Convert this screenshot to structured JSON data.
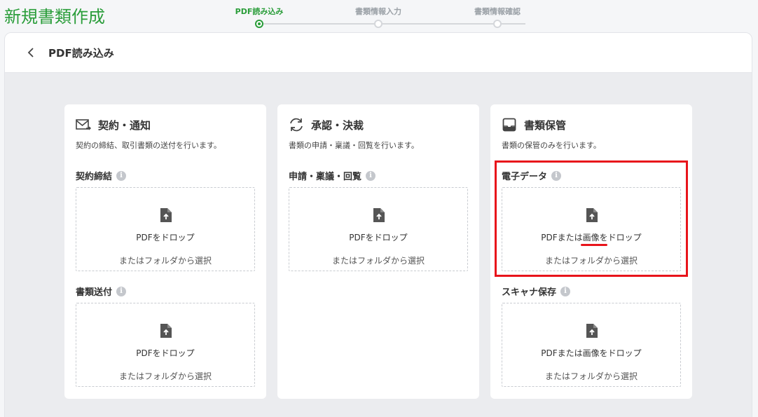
{
  "header": {
    "page_title": "新規書類作成"
  },
  "stepper": {
    "steps": [
      {
        "label": "PDF読み込み",
        "active": true
      },
      {
        "label": "書類情報入力",
        "active": false
      },
      {
        "label": "書類情報確認",
        "active": false
      }
    ]
  },
  "panel": {
    "title": "PDF読み込み"
  },
  "cards": [
    {
      "icon": "mail-send-icon",
      "title": "契約・通知",
      "desc": "契約の締結、取引書類の送付を行います。",
      "sections": [
        {
          "label": "契約締結",
          "drop_text": "PDFをドロップ",
          "drop_sub": "またはフォルダから選択"
        },
        {
          "label": "書類送付",
          "drop_text": "PDFをドロップ",
          "drop_sub": "またはフォルダから選択"
        }
      ]
    },
    {
      "icon": "refresh-icon",
      "title": "承認・決裁",
      "desc": "書類の申請・稟議・回覧を行います。",
      "sections": [
        {
          "label": "申請・稟議・回覧",
          "drop_text": "PDFをドロップ",
          "drop_sub": "またはフォルダから選択"
        }
      ]
    },
    {
      "icon": "inbox-icon",
      "title": "書類保管",
      "desc": "書類の保管のみを行います。",
      "sections": [
        {
          "label": "電子データ",
          "drop_text": "PDFまたは画像をドロップ",
          "drop_sub": "またはフォルダから選択"
        },
        {
          "label": "スキャナ保存",
          "drop_text": "PDFまたは画像をドロップ",
          "drop_sub": "またはフォルダから選択"
        }
      ]
    }
  ],
  "colors": {
    "brand_green": "#2a9d3a",
    "annotation_red": "#e8141b"
  }
}
